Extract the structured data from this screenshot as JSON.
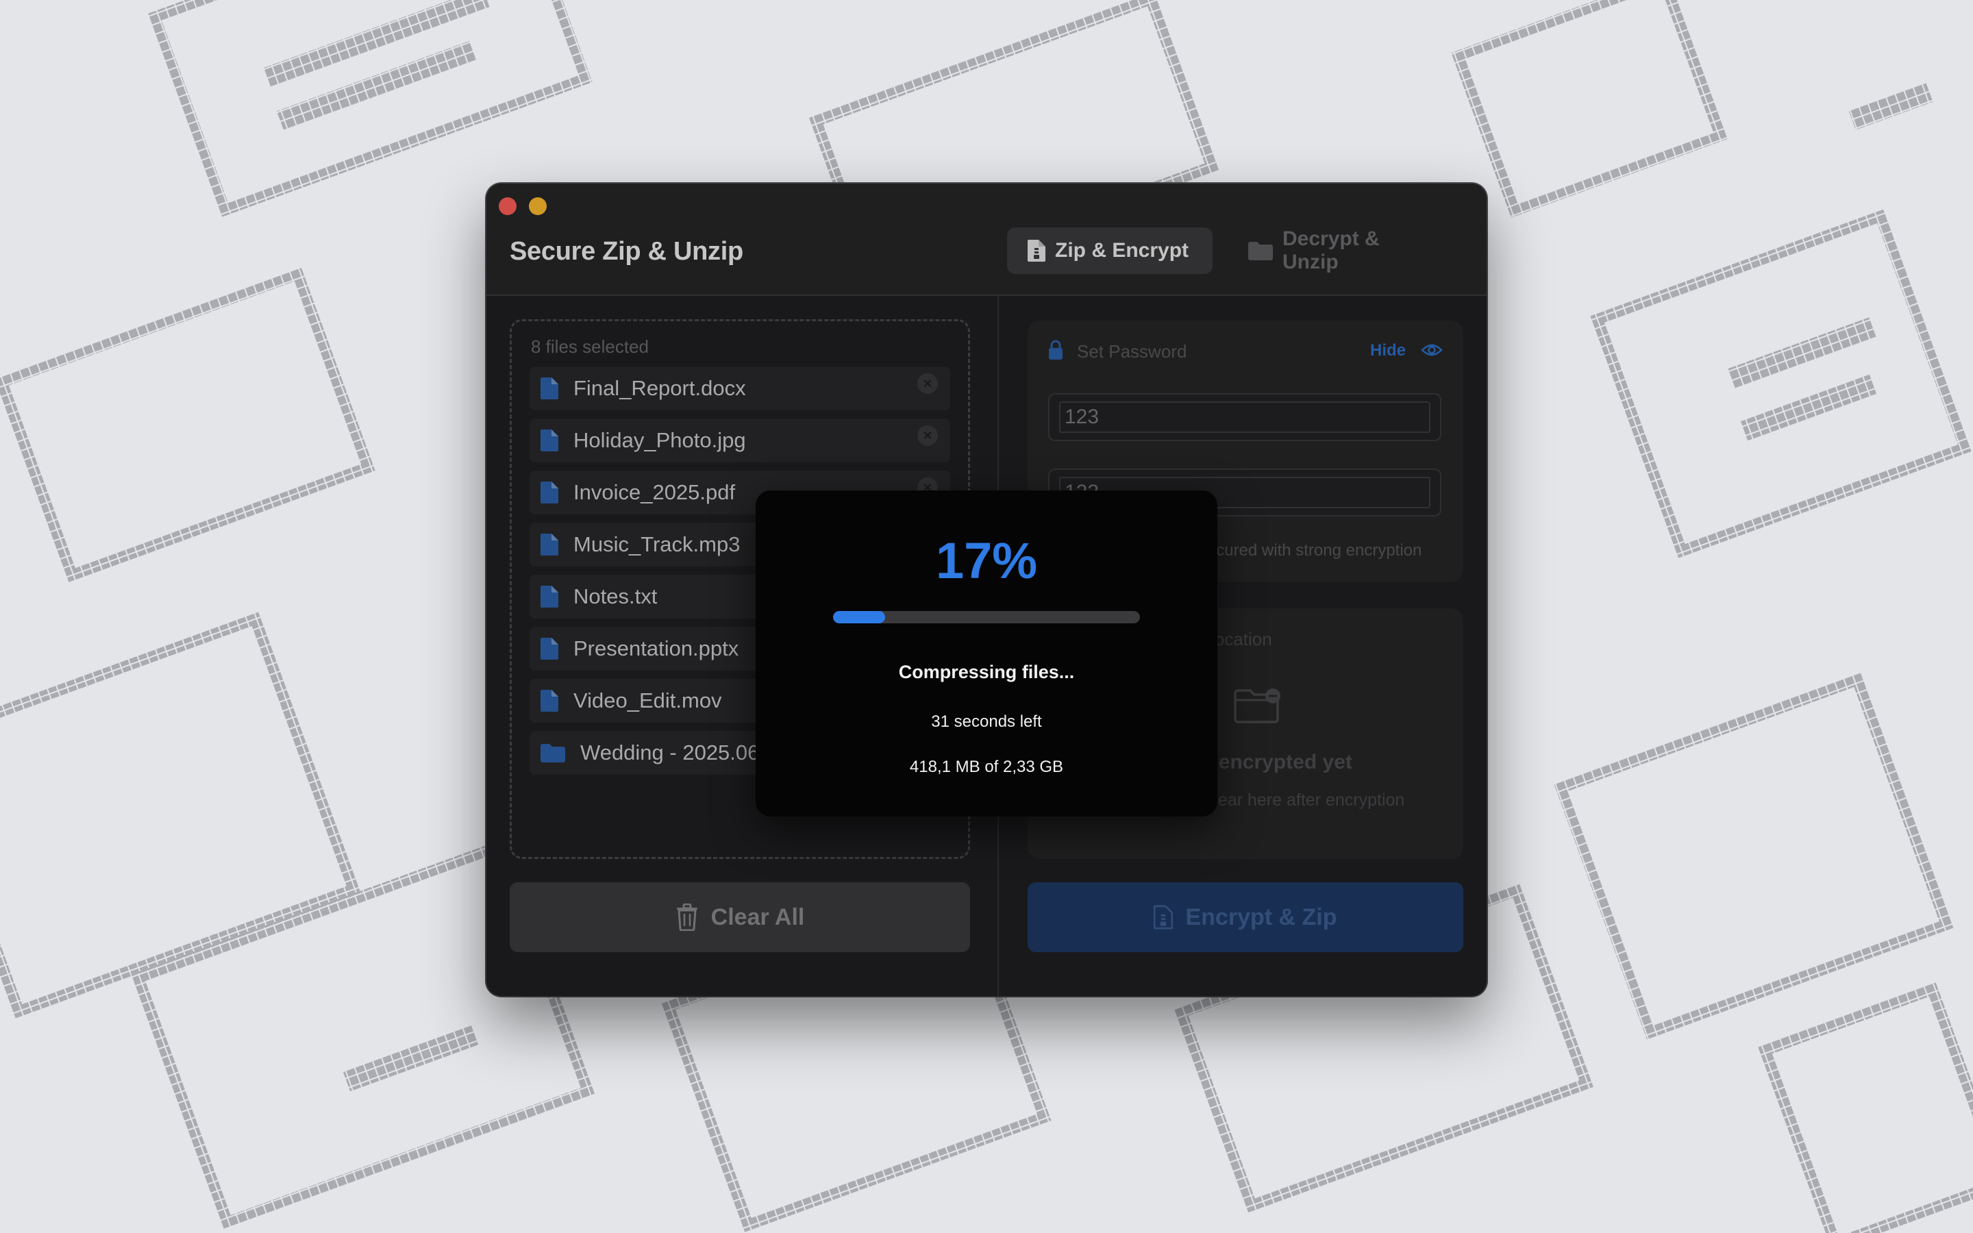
{
  "window": {
    "title": "Secure Zip & Unzip",
    "tabs": [
      {
        "label": "Zip & Encrypt",
        "icon": "zip-doc-icon",
        "active": true
      },
      {
        "label": "Decrypt & Unzip",
        "icon": "folder-icon",
        "active": false
      }
    ]
  },
  "files": {
    "count_label": "8 files selected",
    "items": [
      {
        "name": "Final_Report.docx",
        "icon": "file-icon"
      },
      {
        "name": "Holiday_Photo.jpg",
        "icon": "file-icon"
      },
      {
        "name": "Invoice_2025.pdf",
        "icon": "file-icon"
      },
      {
        "name": "Music_Track.mp3",
        "icon": "file-icon"
      },
      {
        "name": "Notes.txt",
        "icon": "file-icon"
      },
      {
        "name": "Presentation.pptx",
        "icon": "file-icon"
      },
      {
        "name": "Video_Edit.mov",
        "icon": "file-icon"
      },
      {
        "name": "Wedding - 2025.06.14",
        "icon": "folder-icon"
      }
    ],
    "clear_button": "Clear All"
  },
  "password": {
    "title": "Set Password",
    "toggle_label": "Hide",
    "value": "123",
    "confirm_value": "123",
    "hint": "Your files will be secured with strong encryption"
  },
  "location": {
    "title": "Encrypted Files Location",
    "empty_title": "No files encrypted yet",
    "empty_subtitle": "Your files will appear here after encryption"
  },
  "action_button": "Encrypt & Zip",
  "progress": {
    "percent_label": "17%",
    "fraction": 0.17,
    "status": "Compressing files...",
    "time_left": "31 seconds left",
    "size_info": "418,1 MB of 2,33 GB"
  },
  "colors": {
    "accent": "#2f7be6",
    "close": "#ff5f57",
    "minimize": "#febc2e"
  }
}
